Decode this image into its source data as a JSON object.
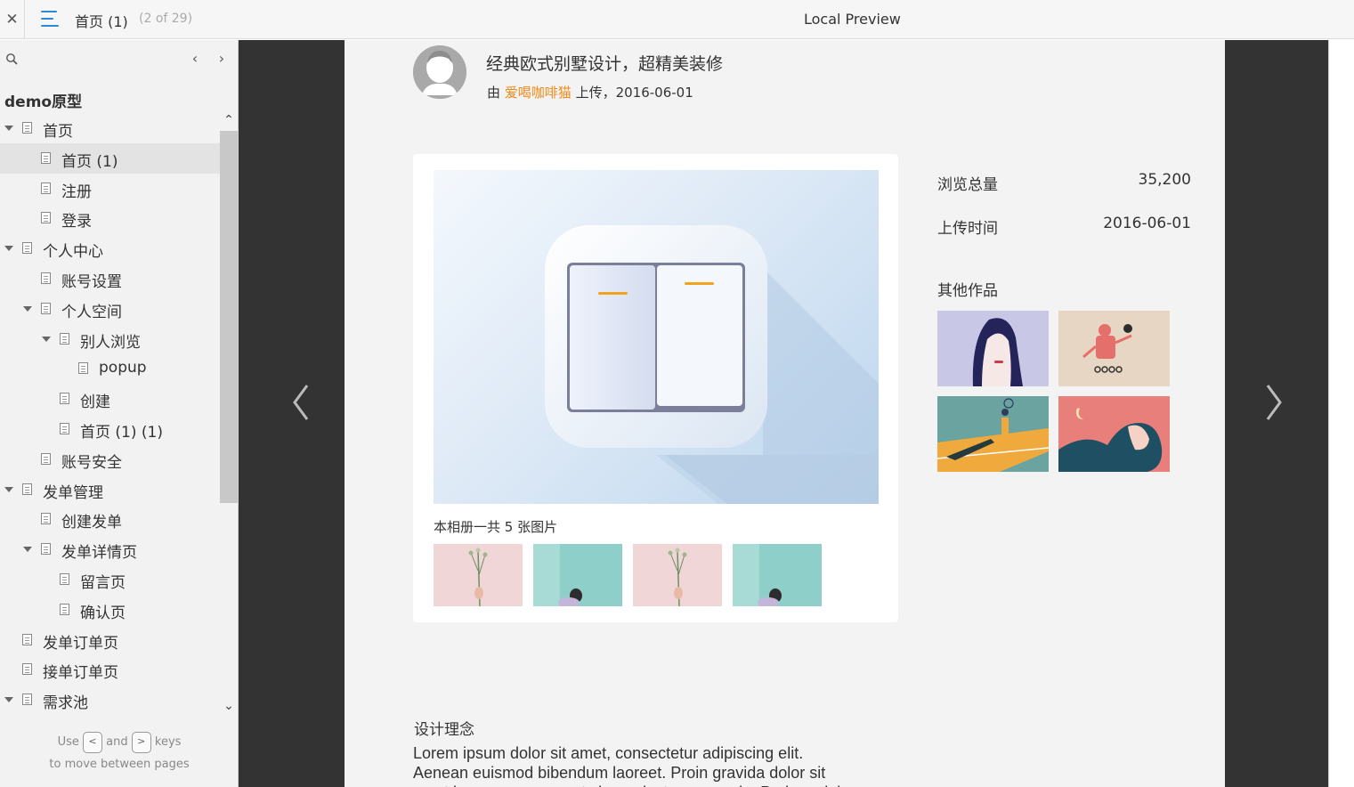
{
  "topbar": {
    "current_page": "首页 (1)",
    "page_count": "(2 of 29)",
    "title": "Local Preview"
  },
  "sidebar": {
    "project_name": "demo原型",
    "tree": [
      {
        "label": "首页",
        "level": 0,
        "expandable": true,
        "selected": false
      },
      {
        "label": "首页 (1)",
        "level": 1,
        "expandable": false,
        "selected": true
      },
      {
        "label": "注册",
        "level": 1,
        "expandable": false,
        "selected": false
      },
      {
        "label": "登录",
        "level": 1,
        "expandable": false,
        "selected": false
      },
      {
        "label": "个人中心",
        "level": 0,
        "expandable": true,
        "selected": false
      },
      {
        "label": "账号设置",
        "level": 1,
        "expandable": false,
        "selected": false
      },
      {
        "label": "个人空间",
        "level": 1,
        "expandable": true,
        "selected": false
      },
      {
        "label": "别人浏览",
        "level": 2,
        "expandable": true,
        "selected": false
      },
      {
        "label": "popup",
        "level": 3,
        "expandable": false,
        "selected": false
      },
      {
        "label": "创建",
        "level": 2,
        "expandable": false,
        "selected": false
      },
      {
        "label": "首页 (1) (1)",
        "level": 2,
        "expandable": false,
        "selected": false
      },
      {
        "label": "账号安全",
        "level": 1,
        "expandable": false,
        "selected": false
      },
      {
        "label": "发单管理",
        "level": 0,
        "expandable": true,
        "selected": false
      },
      {
        "label": "创建发单",
        "level": 1,
        "expandable": false,
        "selected": false
      },
      {
        "label": "发单详情页",
        "level": 1,
        "expandable": true,
        "selected": false
      },
      {
        "label": "留言页",
        "level": 2,
        "expandable": false,
        "selected": false
      },
      {
        "label": "确认页",
        "level": 2,
        "expandable": false,
        "selected": false
      },
      {
        "label": "发单订单页",
        "level": 0,
        "expandable": false,
        "selected": false
      },
      {
        "label": "接单订单页",
        "level": 0,
        "expandable": false,
        "selected": false
      },
      {
        "label": "需求池",
        "level": 0,
        "expandable": true,
        "selected": false
      }
    ],
    "hint": {
      "use": "Use",
      "and": "and",
      "keys": "keys",
      "line2": "to move between pages",
      "key_prev": "<",
      "key_next": ">"
    }
  },
  "content": {
    "title": "经典欧式别墅设计，超精美装修",
    "by": "由",
    "author": "爱喝咖啡猫",
    "uploaded": "上传，2016-06-01",
    "album_text": "本相册一共 5 张图片",
    "stats": [
      {
        "label": "浏览总量",
        "value": "35,200"
      },
      {
        "label": "上传时间",
        "value": "2016-06-01"
      }
    ],
    "others_title": "其他作品",
    "concept_title": "设计理念",
    "concept_text": "Lorem ipsum dolor sit amet, consectetur adipiscing elit. Aenean euismod bibendum laoreet. Proin gravida dolor sit amet lacus accumsan et viverra justo commodo. Proin sodales pulvinar tempor."
  },
  "colors": {
    "accent": "#2b8ad8",
    "author": "#f28a18",
    "stage_bg": "#333333"
  }
}
